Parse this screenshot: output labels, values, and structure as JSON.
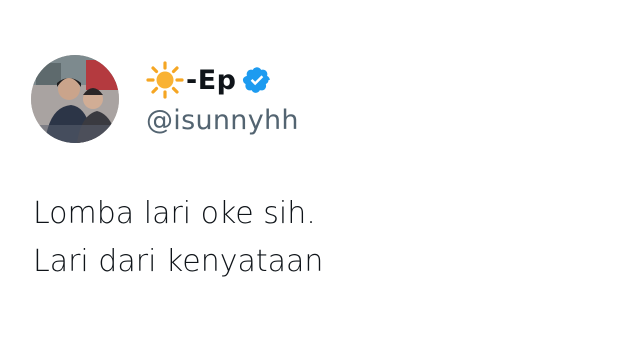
{
  "author": {
    "name_emoji": "sun-icon",
    "display_name": "-Ep",
    "verified": true,
    "verified_icon": "verified-badge-icon",
    "handle": "@isunnyhh",
    "avatar": "avatar"
  },
  "tweet": {
    "lines": [
      "Lomba lari oke sih.",
      "Lari dari kenyataan"
    ]
  },
  "colors": {
    "text": "#0f1419",
    "handle": "#536471",
    "verified": "#1d9bf0",
    "sun": "#f5a623"
  }
}
